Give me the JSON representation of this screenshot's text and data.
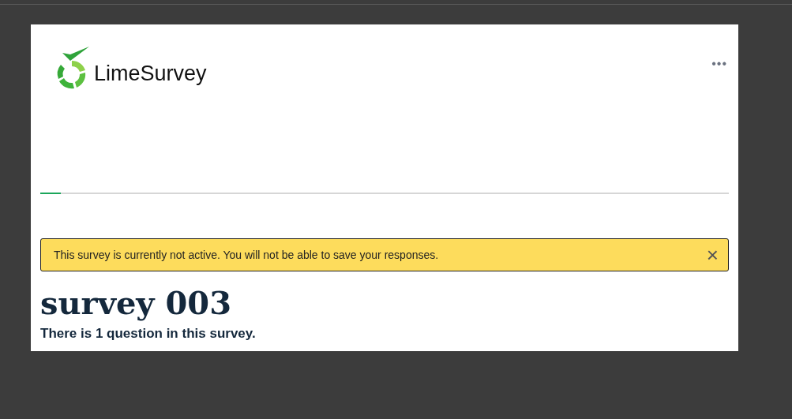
{
  "header": {
    "logo_text": "LimeSurvey",
    "menu": "•••"
  },
  "progress": {
    "level": 0.03
  },
  "alert": {
    "message": "This survey is currently not active. You will not be able to save your responses.",
    "close": "×"
  },
  "survey": {
    "title": "survey 003",
    "subtitle": "There is 1 question in this survey."
  }
}
